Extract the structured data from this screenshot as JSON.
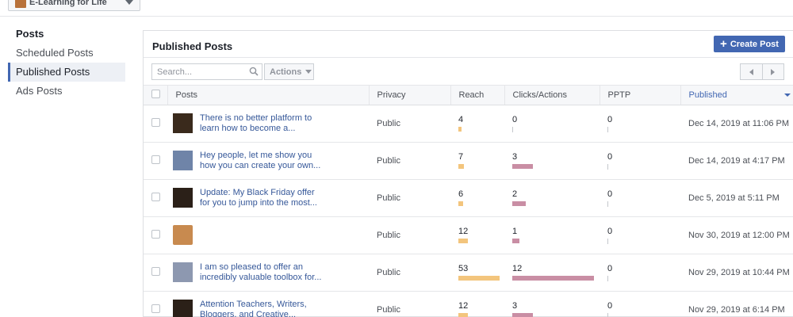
{
  "page_selector": {
    "name": "E-Learning for Life"
  },
  "sidebar": {
    "heading": "Posts",
    "items": [
      {
        "label": "Scheduled Posts",
        "active": false
      },
      {
        "label": "Published Posts",
        "active": true
      },
      {
        "label": "Ads Posts",
        "active": false
      }
    ]
  },
  "panel": {
    "title": "Published Posts",
    "create_label": "Create Post"
  },
  "toolbar": {
    "search_placeholder": "Search...",
    "actions_label": "Actions"
  },
  "table": {
    "columns": [
      "Posts",
      "Privacy",
      "Reach",
      "Clicks/Actions",
      "PPTP",
      "Published"
    ],
    "sorted_column": "Published",
    "max_bar": 53,
    "rows": [
      {
        "text": "There is no better platform to learn how to become a...",
        "privacy": "Public",
        "reach": "4",
        "reach_value": 4,
        "clicks": "0",
        "clicks_value": 0,
        "pptp": "0",
        "published": "Dec 14, 2019 at 11:06 PM",
        "thumb": "#3a2a1c"
      },
      {
        "text": "Hey people, let me show you how you can create your own...",
        "privacy": "Public",
        "reach": "7",
        "reach_value": 7,
        "clicks": "3",
        "clicks_value": 3,
        "pptp": "0",
        "published": "Dec 14, 2019 at 4:17 PM",
        "thumb": "#6f84a8"
      },
      {
        "text": "Update: My Black Friday offer for you to jump into the most...",
        "privacy": "Public",
        "reach": "6",
        "reach_value": 6,
        "clicks": "2",
        "clicks_value": 2,
        "pptp": "0",
        "published": "Dec 5, 2019 at 5:11 PM",
        "thumb": "#2b2018"
      },
      {
        "text": "",
        "privacy": "Public",
        "reach": "12",
        "reach_value": 12,
        "clicks": "1",
        "clicks_value": 1,
        "pptp": "0",
        "published": "Nov 30, 2019 at 12:00 PM",
        "thumb": "#c88a4f"
      },
      {
        "text": "I am so pleased to offer an incredibly valuable toolbox for...",
        "privacy": "Public",
        "reach": "53",
        "reach_value": 53,
        "clicks": "12",
        "clicks_value": 12,
        "pptp": "0",
        "published": "Nov 29, 2019 at 10:44 PM",
        "thumb": "#8d98b0"
      },
      {
        "text": "Attention Teachers, Writers, Bloggers, and Creative...",
        "privacy": "Public",
        "reach": "12",
        "reach_value": 12,
        "clicks": "3",
        "clicks_value": 3,
        "pptp": "0",
        "published": "Nov 29, 2019 at 6:14 PM",
        "thumb": "#2b2018"
      }
    ]
  }
}
